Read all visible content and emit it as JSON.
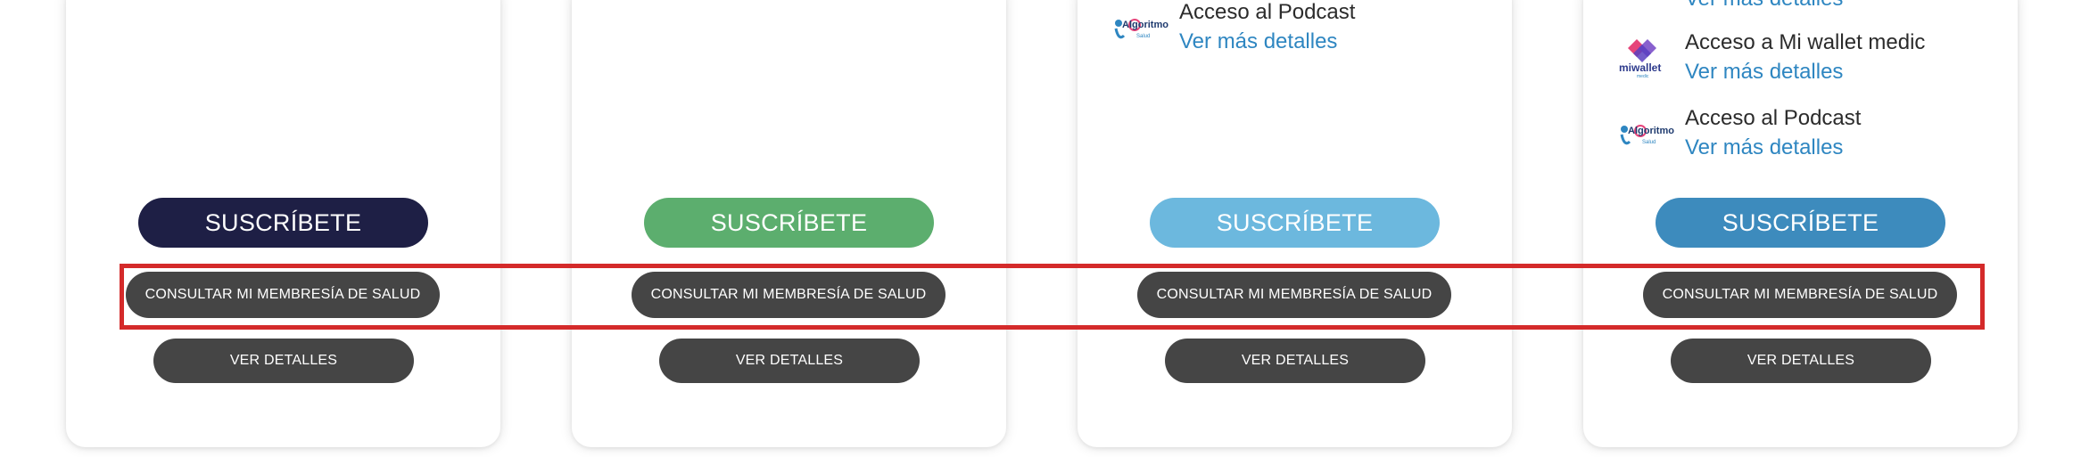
{
  "buttons": {
    "subscribe_label": "SUSCRÍBETE",
    "consult_label": "CONSULTAR MI MEMBRESÍA DE SALUD",
    "details_label": "VER DETALLES"
  },
  "card3": {
    "features": [
      {
        "logo_text": "Algoritmo",
        "logo_sub": "Salud",
        "title": "Acceso al Podcast",
        "link": "Ver más detalles"
      }
    ]
  },
  "card4": {
    "partial_link": "Ver más detalles",
    "features": [
      {
        "logo_text": "miwallet",
        "logo_sub": "medic",
        "title": "Acceso a Mi wallet medic",
        "link": "Ver más detalles"
      },
      {
        "logo_text": "Algoritmo",
        "logo_sub": "Salud",
        "title": "Acceso al Podcast",
        "link": "Ver más detalles"
      }
    ]
  },
  "colors": {
    "subscribe_navy": "#1e1f45",
    "subscribe_green": "#5cae6e",
    "subscribe_light_blue": "#6cb8de",
    "subscribe_blue": "#3d8bbd",
    "dark_button": "#454545",
    "link_blue": "#2e86c1",
    "highlight_red": "#d42a2a"
  },
  "icons": [
    "algoritmo-logo-icon",
    "miwallet-logo-icon"
  ]
}
